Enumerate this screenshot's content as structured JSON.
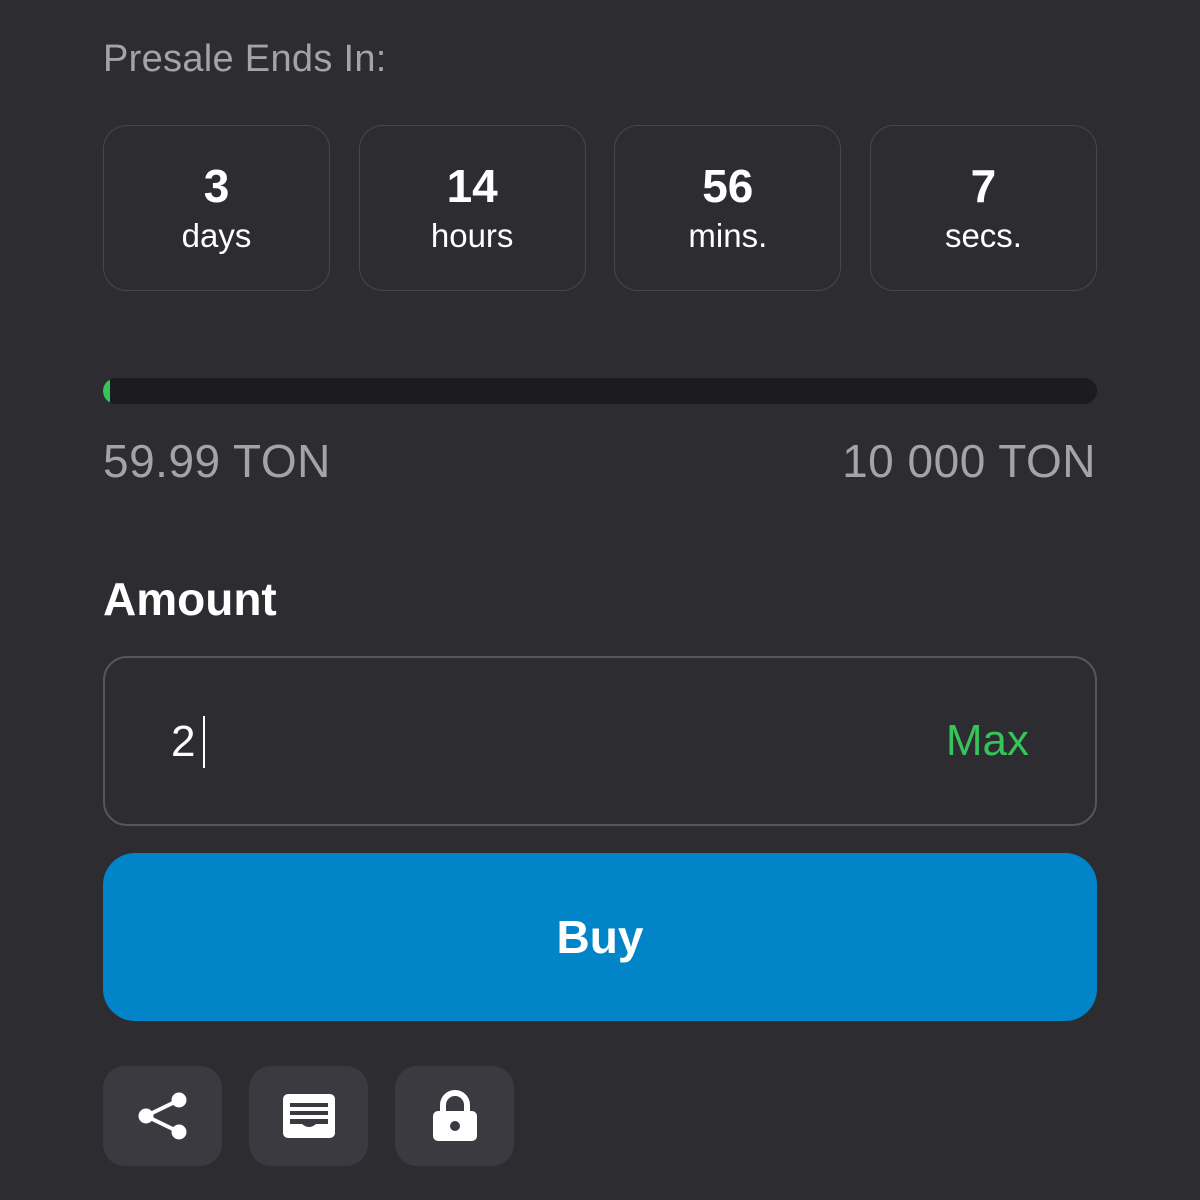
{
  "presale": {
    "label": "Presale Ends In:"
  },
  "countdown": [
    {
      "value": "3",
      "unit": "days"
    },
    {
      "value": "14",
      "unit": "hours"
    },
    {
      "value": "56",
      "unit": "mins."
    },
    {
      "value": "7",
      "unit": "secs."
    }
  ],
  "progress": {
    "raised": "59.99 TON",
    "goal": "10 000 TON",
    "fraction": 0.006,
    "fill_color": "#35c45a",
    "track_color": "#1c1c1f"
  },
  "amount": {
    "label": "Amount",
    "value": "2",
    "max_label": "Max",
    "max_color": "#35c45a"
  },
  "buy": {
    "label": "Buy",
    "color": "#0285c8"
  },
  "icons": [
    "share-icon",
    "wallet-card-icon",
    "lock-icon"
  ]
}
